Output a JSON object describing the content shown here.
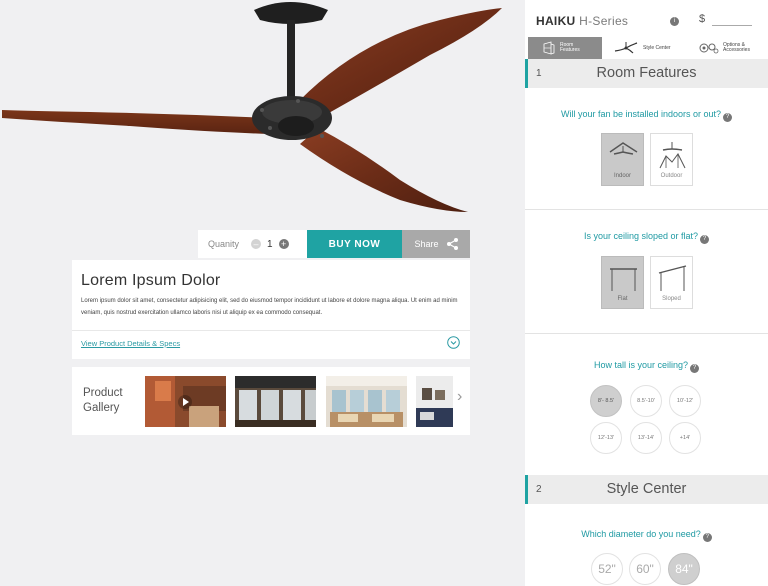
{
  "product": {
    "quantity_label": "Quanity",
    "quantity_value": "1",
    "buy_label": "BUY NOW",
    "share_label": "Share",
    "title": "Lorem Ipsum Dolor",
    "description": "Lorem ipsum dolor sit amet, consectetur adipisicing elit, sed do eiusmod tempor incididunt ut labore et dolore magna aliqua. Ut enim ad minim veniam, quis nostrud exercitation ullamco laboris nisi ut aliquip ex ea commodo consequat.",
    "details_link": "View Product Details & Specs",
    "gallery_title": "Product Gallery"
  },
  "configurator": {
    "brand": "HAIKU",
    "series": "H-Series",
    "price_symbol": "$",
    "tabs": [
      {
        "label": "Room Features",
        "icon": "room-features-icon",
        "active": true
      },
      {
        "label": "Style Center",
        "icon": "fan-style-icon",
        "active": false
      },
      {
        "label": "Options & Accessories",
        "icon": "gears-icon",
        "active": false
      }
    ],
    "sections": [
      {
        "number": "1",
        "title": "Room Features"
      },
      {
        "number": "2",
        "title": "Style Center"
      }
    ],
    "questions": {
      "location": "Will your fan be installed indoors or out?",
      "ceiling_type": "Is your ceiling sloped or flat?",
      "ceiling_height": "How tall is your ceiling?",
      "diameter": "Which diameter do you need?"
    },
    "location_options": [
      "Indoor",
      "Outdoor"
    ],
    "location_selected": "Indoor",
    "ceiling_options": [
      "Flat",
      "Sloped"
    ],
    "ceiling_selected": "Flat",
    "height_options": [
      "8'- 8.5'",
      "8.5'-10'",
      "10'-12'",
      "12'-13'",
      "13'-14'",
      "+14'"
    ],
    "height_selected": "8'- 8.5'",
    "diameter_options": [
      "52\"",
      "60\"",
      "84\""
    ],
    "diameter_selected": "84\""
  },
  "colors": {
    "accent": "#1fa3a3",
    "blade_wood": "#6e2e18",
    "motor": "#2a2a2a"
  }
}
